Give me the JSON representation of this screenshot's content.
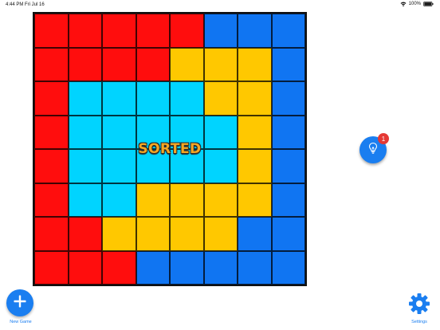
{
  "status": {
    "time": "4:44 PM",
    "date": "Fri Jul 16",
    "battery": "100%"
  },
  "colors": {
    "R": "#ff0d0d",
    "B": "#1075f2",
    "Y": "#ffc800",
    "C": "#00d4ff"
  },
  "board": {
    "rows": [
      [
        "R",
        "R",
        "R",
        "R",
        "R",
        "B",
        "B",
        "B"
      ],
      [
        "R",
        "R",
        "R",
        "R",
        "Y",
        "Y",
        "Y",
        "B"
      ],
      [
        "R",
        "C",
        "C",
        "C",
        "C",
        "Y",
        "Y",
        "B"
      ],
      [
        "R",
        "C",
        "C",
        "C",
        "C",
        "C",
        "Y",
        "B"
      ],
      [
        "R",
        "C",
        "C",
        "C",
        "C",
        "C",
        "Y",
        "B"
      ],
      [
        "R",
        "C",
        "C",
        "Y",
        "Y",
        "Y",
        "Y",
        "B"
      ],
      [
        "R",
        "R",
        "Y",
        "Y",
        "Y",
        "Y",
        "B",
        "B"
      ],
      [
        "R",
        "R",
        "R",
        "B",
        "B",
        "B",
        "B",
        "B"
      ]
    ],
    "status_text": "SORTED"
  },
  "hint": {
    "badge": "1",
    "icon": "lightbulb-icon"
  },
  "toolbar": {
    "new_game_label": "New Game",
    "settings_label": "Settings"
  }
}
